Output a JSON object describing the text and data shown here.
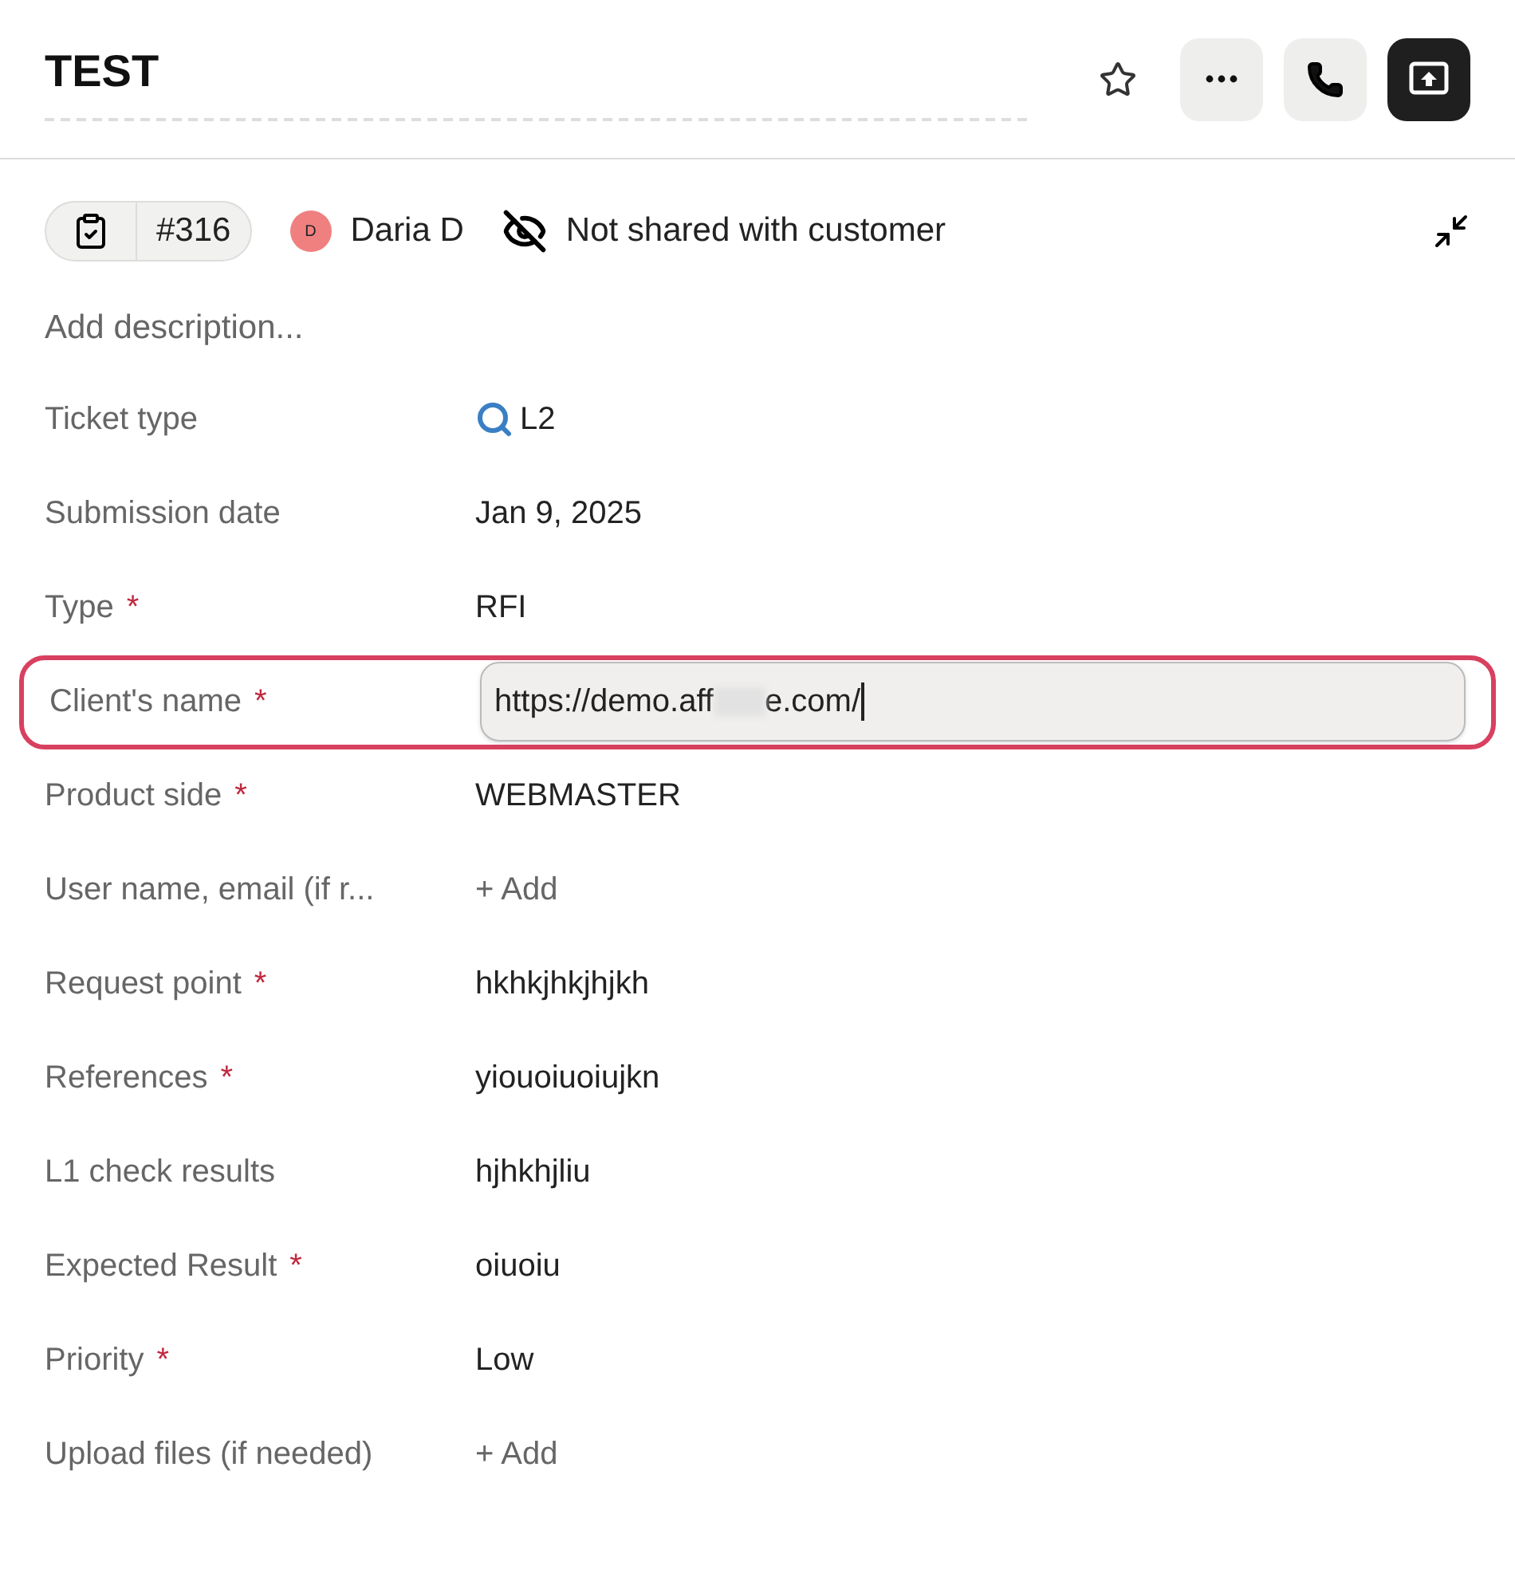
{
  "header": {
    "title": "TEST"
  },
  "meta": {
    "ticket_number": "#316",
    "assignee": {
      "initial": "D",
      "name": "Daria D",
      "color": "#f08080"
    },
    "visibility": "Not shared with customer"
  },
  "description": {
    "placeholder": "Add description..."
  },
  "fields": [
    {
      "kind": "ticket_type",
      "label": "Ticket type",
      "value": "L2"
    },
    {
      "kind": "text",
      "label": "Submission date",
      "value": "Jan 9, 2025"
    },
    {
      "kind": "text",
      "label": "Type",
      "required_mark": "*",
      "value": "RFI"
    },
    {
      "kind": "input",
      "label": "Client's name",
      "required_mark": "*",
      "value_start": "https://demo.aff",
      "value_end": "e.com/",
      "highlighted": true
    },
    {
      "kind": "text",
      "label": "Product side",
      "required_mark": "*",
      "value": "WEBMASTER"
    },
    {
      "kind": "add",
      "label": "User name, email (if r...",
      "value": "+ Add"
    },
    {
      "kind": "text",
      "label": "Request point",
      "required_mark": "*",
      "value": "hkhkjhkjhjkh"
    },
    {
      "kind": "text",
      "label": "References",
      "required_mark": "*",
      "value": "yiouoiuoiujkn"
    },
    {
      "kind": "text",
      "label": "L1 check results",
      "value": "hjhkhjliu"
    },
    {
      "kind": "text",
      "label": "Expected Result",
      "required_mark": "*",
      "value": "oiuoiu"
    },
    {
      "kind": "text",
      "label": "Priority",
      "required_mark": "*",
      "value": "Low"
    },
    {
      "kind": "add",
      "label": "Upload files (if needed)",
      "value": "+ Add"
    }
  ]
}
